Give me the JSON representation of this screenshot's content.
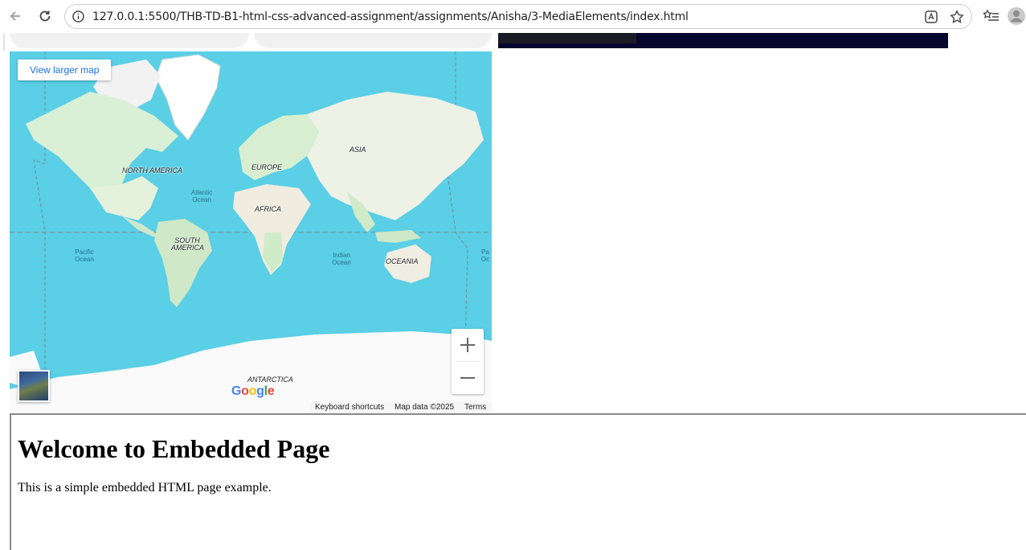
{
  "browser": {
    "url": "127.0.0.1:5500/THB-TD-B1-html-css-advanced-assignment/assignments/Anisha/3-MediaElements/index.html",
    "icons": [
      "back-arrow-icon",
      "reload-icon",
      "site-info-icon",
      "translate-icon",
      "star-icon",
      "reading-list-icon",
      "profile-icon"
    ]
  },
  "map": {
    "view_larger_map": "View larger map",
    "continents": {
      "north_america": "NORTH AMERICA",
      "south_america": "SOUTH AMERICA",
      "europe": "EUROPE",
      "asia": "ASIA",
      "africa": "AFRICA",
      "oceania": "OCEANIA",
      "antarctica": "ANTARCTICA"
    },
    "oceans": {
      "atlantic": "Atlantic Ocean",
      "pacific": "Pacific Ocean",
      "indian": "Indian Ocean",
      "pacific_right": "Pa Oc"
    },
    "google": "Google",
    "attribution": {
      "keyboard": "Keyboard shortcuts",
      "map_data": "Map data ©2025",
      "terms": "Terms"
    },
    "colors": {
      "water": "#5acfe5",
      "land": "#e6f0de",
      "accent": "#1a73e8"
    }
  },
  "embedded": {
    "heading": "Welcome to Embedded Page",
    "text": "This is a simple embedded HTML page example."
  }
}
